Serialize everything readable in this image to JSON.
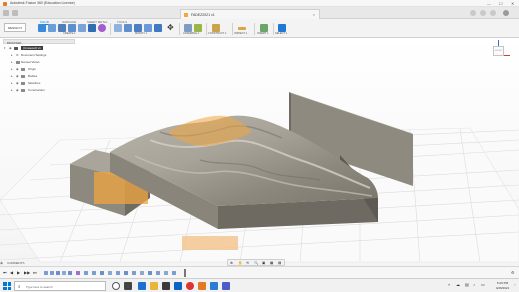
{
  "window": {
    "title": "Autodesk Fusion 360 (Education License)",
    "controls": [
      "—",
      "☐",
      "✕"
    ]
  },
  "document_tab": {
    "title": "FADEZ2021 v1",
    "close": "×"
  },
  "ribbon": {
    "tabs": [
      "SOLID",
      "SURFACE",
      "SHEET METAL",
      "TOOLS"
    ],
    "active_tab": "SOLID",
    "workspace": "DESIGN ▾",
    "groups": [
      "CREATE ▾",
      "MODIFY ▾",
      "ASSEMBLE ▾",
      "CONSTRUCT ▾",
      "INSPECT ▾",
      "INSERT ▾",
      "SELECT ▾"
    ]
  },
  "browser": {
    "header": "BROWSER",
    "items": [
      {
        "label": "(Unsaved) v1",
        "root": true
      },
      {
        "label": "Document Settings"
      },
      {
        "label": "Named Views"
      },
      {
        "label": "Origin"
      },
      {
        "label": "Bodies"
      },
      {
        "label": "Sketches"
      },
      {
        "label": "Construction"
      }
    ]
  },
  "viewcube": {
    "face": "FRONT"
  },
  "comments": {
    "label": "COMMENTS"
  },
  "navbar": {
    "icons": [
      "⊕",
      "✋",
      "⟲",
      "🔍",
      "▣",
      "▦",
      "▤"
    ]
  },
  "timeline": {
    "controls": [
      "⏮",
      "◀",
      "▶",
      "▶▶",
      "⏭"
    ],
    "settings": "⚙"
  },
  "taskbar": {
    "search_placeholder": "Type here to search",
    "time": "5:29 PM",
    "date": "4/26/2021"
  },
  "colors": {
    "accent": "#0a7ed8",
    "model_body": "#8f8a7f",
    "highlight": "#f0a640"
  }
}
